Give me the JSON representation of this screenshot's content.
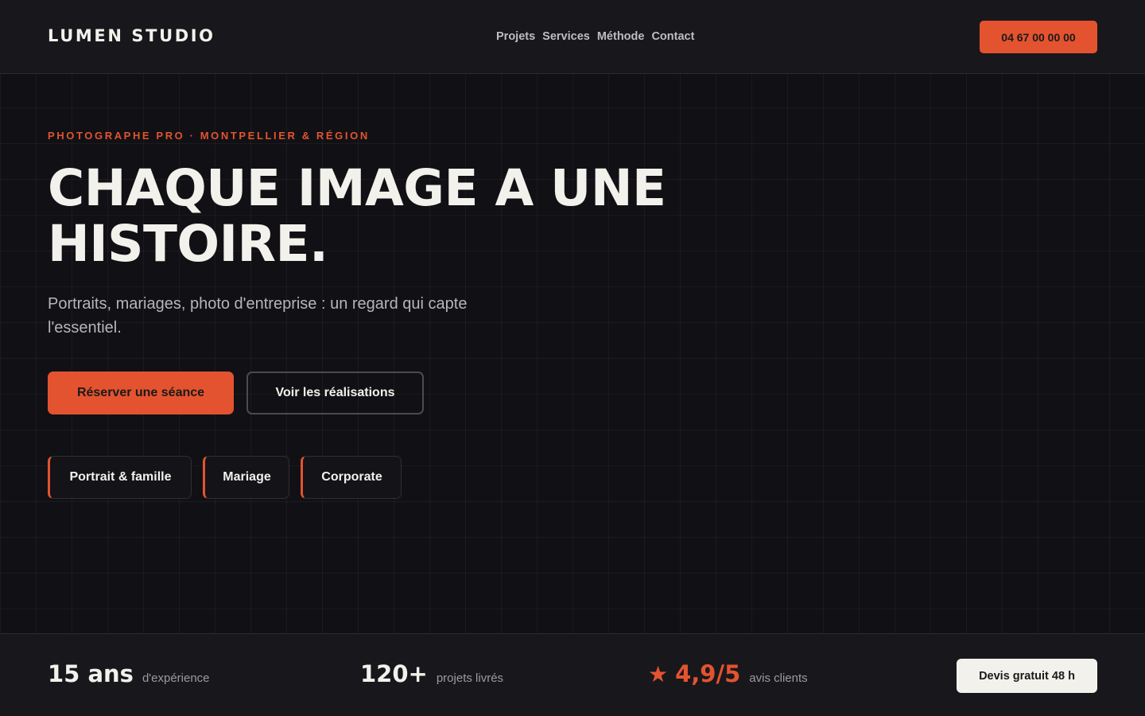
{
  "header": {
    "logo": "LUMEN STUDIO",
    "nav": [
      "Projets",
      "Services",
      "Méthode",
      "Contact"
    ],
    "phone": "04 67 00 00 00"
  },
  "hero": {
    "eyebrow": "PHOTOGRAPHE PRO · MONTPELLIER & RÉGION",
    "headline_line1": "CHAQUE IMAGE A UNE",
    "headline_line2": "HISTOIRE.",
    "subtitle": "Portraits, mariages, photo d'entreprise : un regard qui capte l'essentiel.",
    "cta_primary": "Réserver une séance",
    "cta_secondary": "Voir les réalisations",
    "categories": [
      "Portrait & famille",
      "Mariage",
      "Corporate"
    ]
  },
  "stats": {
    "items": [
      {
        "value": "15 ans",
        "label": "d'expérience"
      },
      {
        "value": "120+",
        "label": "projets livrés"
      },
      {
        "value": "4,9/5",
        "label": "avis clients",
        "icon": "star-icon"
      }
    ],
    "quote_button": "Devis gratuit 48 h"
  },
  "colors": {
    "accent": "#e4532f",
    "background": "#111115",
    "text": "#f3f1ec"
  }
}
